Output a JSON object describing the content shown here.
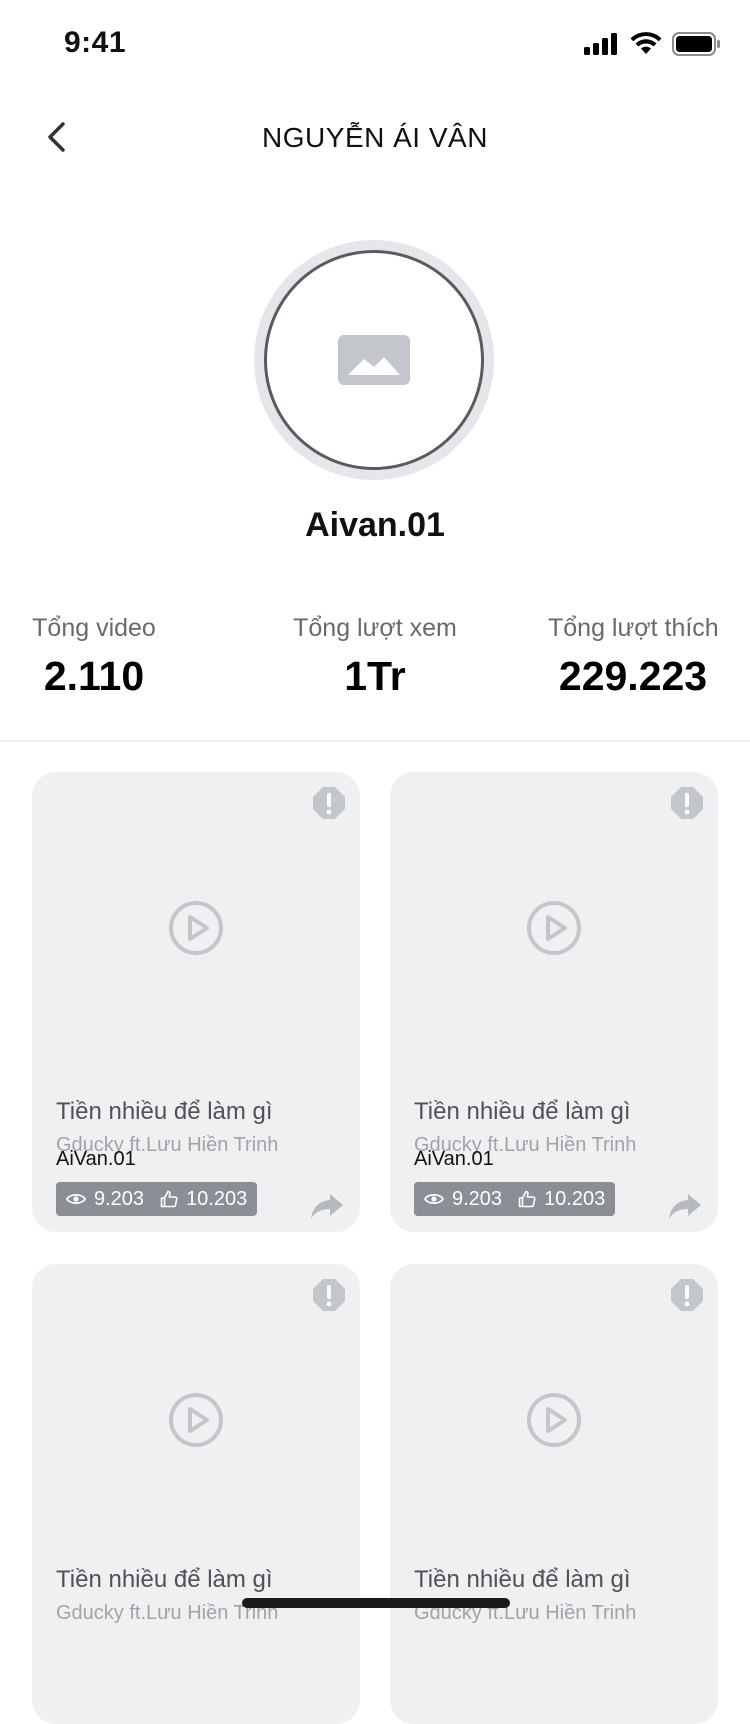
{
  "status_bar": {
    "time": "9:41"
  },
  "nav": {
    "title": "NGUYỄN ÁI VÂN"
  },
  "profile": {
    "username": "Aivan.01"
  },
  "stats": [
    {
      "label": "Tổng video",
      "value": "2.110"
    },
    {
      "label": "Tổng lượt xem",
      "value": "1Tr"
    },
    {
      "label": "Tổng lượt thích",
      "value": "229.223"
    }
  ],
  "videos": [
    {
      "title": "Tiền nhiều để làm gì",
      "artist": "Gducky ft.Lưu Hiền Trinh",
      "owner": "AiVan.01",
      "views": "9.203",
      "likes": "10.203"
    },
    {
      "title": "Tiền nhiều để làm gì",
      "artist": "Gducky ft.Lưu Hiền Trinh",
      "owner": "AiVan.01",
      "views": "9.203",
      "likes": "10.203"
    },
    {
      "title": "Tiền nhiều để làm gì",
      "artist": "Gducky ft.Lưu Hiền Trinh"
    },
    {
      "title": "Tiền nhiều để làm gì",
      "artist": "Gducky ft.Lưu Hiền Trinh"
    }
  ],
  "colors": {
    "card_bg": "#eff0f2",
    "icon_gray": "#c3c6cb",
    "stats_badge_bg": "#8b8f95"
  },
  "icons": {
    "back": "chevron-left-icon",
    "alert": "alert-icon",
    "play": "play-circle-icon",
    "views": "eye-icon",
    "likes": "thumbs-up-icon",
    "share": "share-icon",
    "avatar_placeholder": "image-placeholder-icon"
  }
}
